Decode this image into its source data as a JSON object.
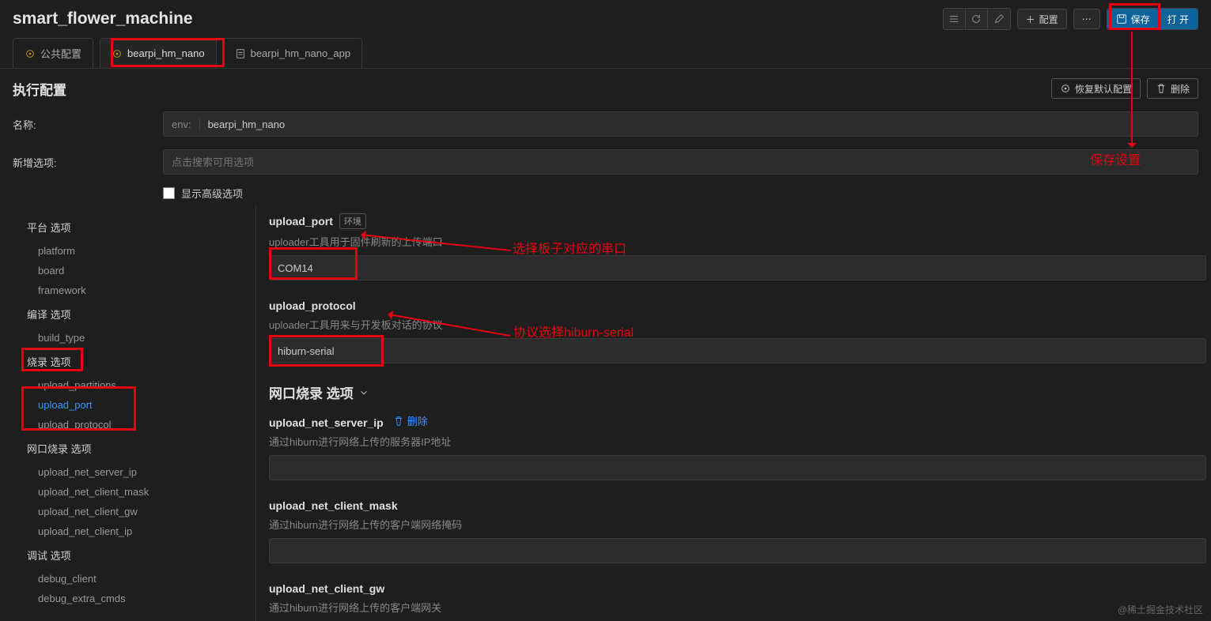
{
  "header": {
    "title": "smart_flower_machine",
    "btn_config": "配置",
    "btn_save": "保存",
    "btn_open": "打 开"
  },
  "tabs": [
    {
      "label": "公共配置",
      "icon": "target"
    },
    {
      "label": "bearpi_hm_nano",
      "icon": "target"
    },
    {
      "label": "bearpi_hm_nano_app",
      "icon": "doc"
    }
  ],
  "config": {
    "section_title": "执行配置",
    "btn_restore": "恢复默认配置",
    "btn_delete": "删除",
    "name_label": "名称:",
    "name_prefix": "env:",
    "name_value": "bearpi_hm_nano",
    "new_opt_label": "新增选项:",
    "new_opt_placeholder": "点击搜索可用选项",
    "advanced_label": "显示高级选项"
  },
  "sidebar": {
    "groups": [
      {
        "title": "平台 选项",
        "items": [
          "platform",
          "board",
          "framework"
        ]
      },
      {
        "title": "编译 选项",
        "items": [
          "build_type"
        ]
      },
      {
        "title": "烧录 选项",
        "items": [
          "upload_partitions",
          "upload_port",
          "upload_protocol"
        ]
      },
      {
        "title": "网口烧录 选项",
        "items": [
          "upload_net_server_ip",
          "upload_net_client_mask",
          "upload_net_client_gw",
          "upload_net_client_ip"
        ]
      },
      {
        "title": "调试 选项",
        "items": [
          "debug_client",
          "debug_extra_cmds"
        ]
      }
    ]
  },
  "content": {
    "opts": [
      {
        "title": "upload_port",
        "badge": "环境",
        "desc": "uploader工具用于固件刷新的上传端口",
        "value": "COM14"
      },
      {
        "title": "upload_protocol",
        "badge": "",
        "desc": "uploader工具用来与开发板对话的协议",
        "value": "hiburn-serial"
      }
    ],
    "subsection": "网口烧录 选项",
    "net_opts": [
      {
        "title": "upload_net_server_ip",
        "delete": "删除",
        "desc": "通过hiburn进行网络上传的服务器IP地址",
        "value": ""
      },
      {
        "title": "upload_net_client_mask",
        "delete": "",
        "desc": "通过hiburn进行网络上传的客户端网络掩码",
        "value": ""
      },
      {
        "title": "upload_net_client_gw",
        "delete": "",
        "desc": "通过hiburn进行网络上传的客户端网关",
        "value": ""
      }
    ]
  },
  "annotations": {
    "save": "保存设置",
    "port": "选择板子对应的串口",
    "protocol": "协议选择hiburn-serial"
  },
  "watermark": "@稀土掘金技术社区"
}
